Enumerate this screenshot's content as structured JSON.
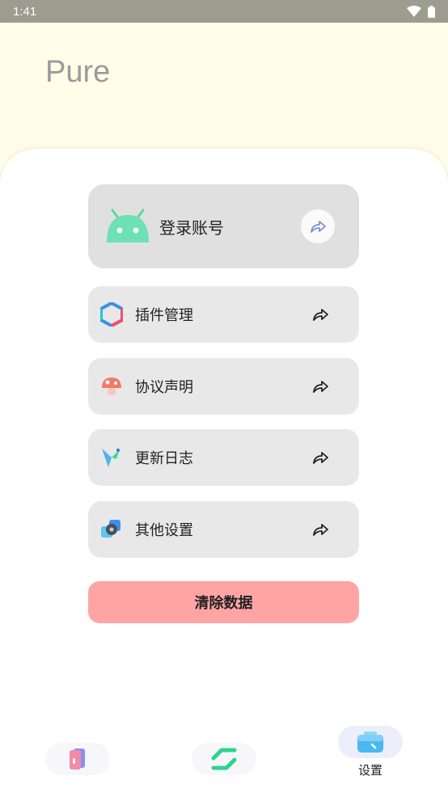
{
  "status_bar": {
    "time": "1:41",
    "icons": [
      "wifi-icon",
      "battery-icon"
    ]
  },
  "app": {
    "title": "Pure"
  },
  "login": {
    "label": "登录账号",
    "icon": "android-icon",
    "arrow_icon": "share-arrow-icon"
  },
  "menu": [
    {
      "label": "插件管理",
      "icon": "hexagon-icon"
    },
    {
      "label": "协议声明",
      "icon": "mushroom-icon"
    },
    {
      "label": "更新日志",
      "icon": "bird-icon"
    },
    {
      "label": "其他设置",
      "icon": "gear-icon"
    }
  ],
  "clear_button": {
    "label": "清除数据",
    "color": "#ffa4a4"
  },
  "bottom_nav": [
    {
      "label": "",
      "icon": "cards-icon"
    },
    {
      "label": "",
      "icon": "transfer-icon"
    },
    {
      "label": "设置",
      "icon": "toolbox-icon",
      "active": true
    }
  ],
  "colors": {
    "header_bg": "#fffde7",
    "status_bar": "#9c9c8f",
    "card_bg": "#e8e8e8",
    "login_card_bg": "#e0e0e0"
  }
}
